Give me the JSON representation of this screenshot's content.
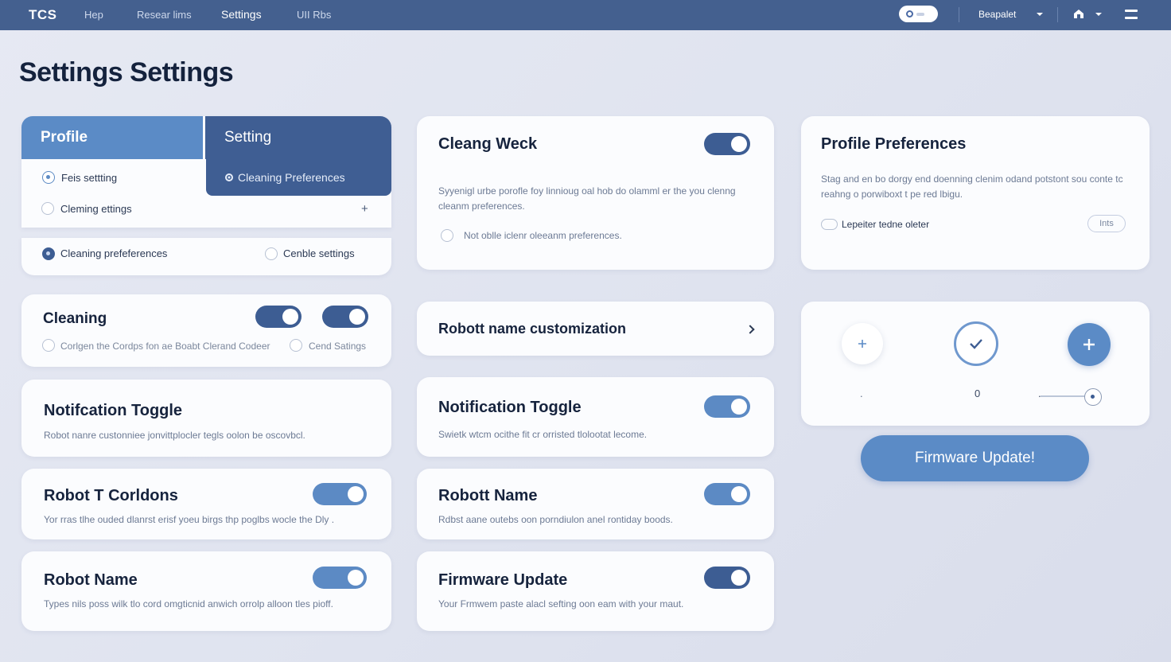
{
  "topbar": {
    "brand": "TCS",
    "nav": [
      "Hep",
      "Resear lims",
      "Settings",
      "UII Rbs"
    ],
    "active_nav": "Settings",
    "select_label": "Beapalet",
    "bg": "#44608f"
  },
  "page": {
    "title": "Settings Settings"
  },
  "tabs_card": {
    "tab_profile": "Profile",
    "tab_setting": "Setting",
    "submenu_item": "Cleaning Preferences",
    "options": [
      "Feis settting",
      "Cleming ettings"
    ],
    "add_symbol": "+",
    "bottom_options": [
      "Cleaning prefeferences",
      "Cenble settings"
    ]
  },
  "cleaning_card": {
    "title": "Cleaning",
    "options": [
      "Corlgen the Cordps fon ae Boabt Clerand Codeer",
      "Cend Satings"
    ]
  },
  "notification_card_left": {
    "title": "Notifcation Toggle",
    "desc": "Robot nanre custonniee jonvittplocler tegls oolon be oscovbcl."
  },
  "robot_t_card": {
    "title": "Robot T Corldons",
    "desc": "Yor rras tlhe ouded dlanrst erisf yoeu birgs thp poglbs wocle the Dly ."
  },
  "robot_name_left": {
    "title": "Robot Name",
    "desc": "Types nils poss wilk tlo cord omgticnid anwich orrolp alloon tles pioff."
  },
  "cleaning_week_card": {
    "title": "Cleang Weck",
    "desc": "Syyenigl urbe porofle foy linnioug oal hob do olamml er the you clenng cleanm preferences.",
    "option": "Not oblle iclenr oleeanm preferences."
  },
  "robot_customization": {
    "title": "Robott name customization"
  },
  "notification_card_mid": {
    "title": "Notification Toggle",
    "desc": "Swietk wtcm ocithe fit cr orristed tlolootat lecome."
  },
  "robot_name_mid": {
    "title": "Robott Name",
    "desc": "Rdbst aane outebs oon porndiulon anel rontiday boods."
  },
  "firmware_card": {
    "title": "Firmware Update",
    "desc": "Your Frmwem paste alacl sefting oon eam with your maut."
  },
  "profile_prefs": {
    "title": "Profile Preferences",
    "desc": "Stag and en bo dorgy end doenning clenim odand potstont sou conte tc reahng o porwiboxt t pe red lbigu.",
    "toggle_label": "Lepeiter tedne oleter",
    "pill_label": "Ints"
  },
  "controls_card": {
    "readouts": [
      ".",
      "0",
      "."
    ],
    "slider_value": 0.65
  },
  "firmware_button": {
    "label": "Firmware Update!"
  },
  "colors": {
    "accent_dark": "#3d5d93",
    "accent_light": "#5b8bc6",
    "background": "#e3e6f1"
  }
}
